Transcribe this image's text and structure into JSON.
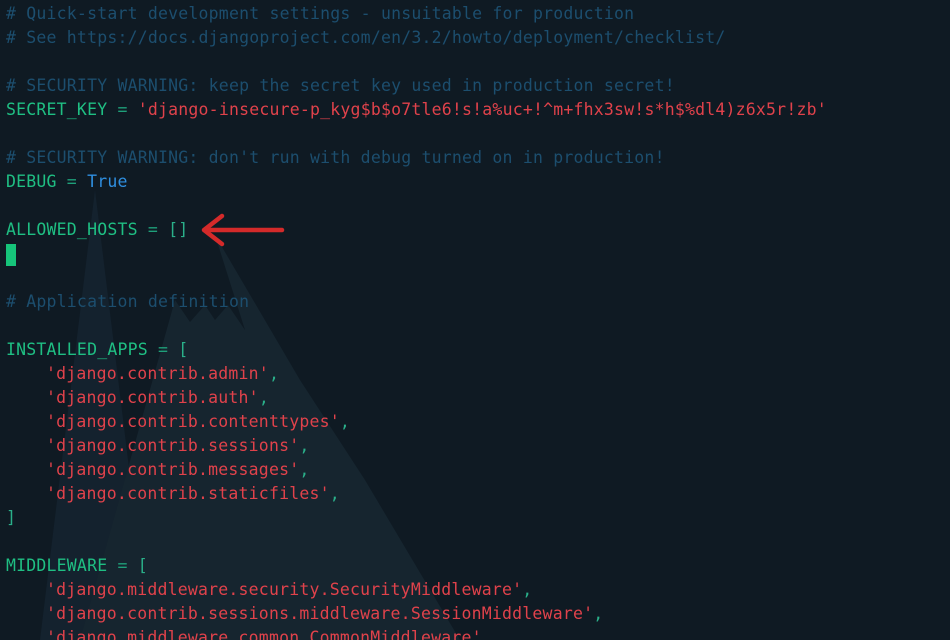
{
  "editor": {
    "lines": {
      "l1": "# Quick-start development settings - unsuitable for production",
      "l2": "# See https://docs.djangoproject.com/en/3.2/howto/deployment/checklist/",
      "l4": "# SECURITY WARNING: keep the secret key used in production secret!",
      "l5_name": "SECRET_KEY",
      "l5_op": " = ",
      "l5_value": "'django-insecure-p_kyg$b$o7tle6!s!a%uc+!^m+fhx3sw!s*h$%dl4)z6x5r!zb'",
      "l7": "# SECURITY WARNING: don't run with debug turned on in production!",
      "l8_name": "DEBUG",
      "l8_op": " = ",
      "l8_value": "True",
      "l10_name": "ALLOWED_HOSTS",
      "l10_op": " = ",
      "l10_value": "[]",
      "l13": "# Application definition",
      "l15_name": "INSTALLED_APPS",
      "l15_op": " = ",
      "l15_open": "[",
      "apps": [
        "'django.contrib.admin'",
        "'django.contrib.auth'",
        "'django.contrib.contenttypes'",
        "'django.contrib.sessions'",
        "'django.contrib.messages'",
        "'django.contrib.staticfiles'"
      ],
      "comma": ",",
      "l22_close": "]",
      "l24_name": "MIDDLEWARE",
      "l24_op": " = ",
      "l24_open": "[",
      "middleware": [
        "'django.middleware.security.SecurityMiddleware'",
        "'django.contrib.sessions.middleware.SessionMiddleware'",
        "'django.middleware.common.CommonMiddleware'"
      ]
    }
  },
  "annotation": {
    "arrow_color": "#d42a2a",
    "arrow_target": "ALLOWED_HOSTS"
  },
  "colors": {
    "background": "#0f1a23",
    "comment": "#1c4e6e",
    "variable": "#1fbf83",
    "string": "#e0424b",
    "keyword": "#2f8fe0",
    "cursor": "#16c47a"
  }
}
